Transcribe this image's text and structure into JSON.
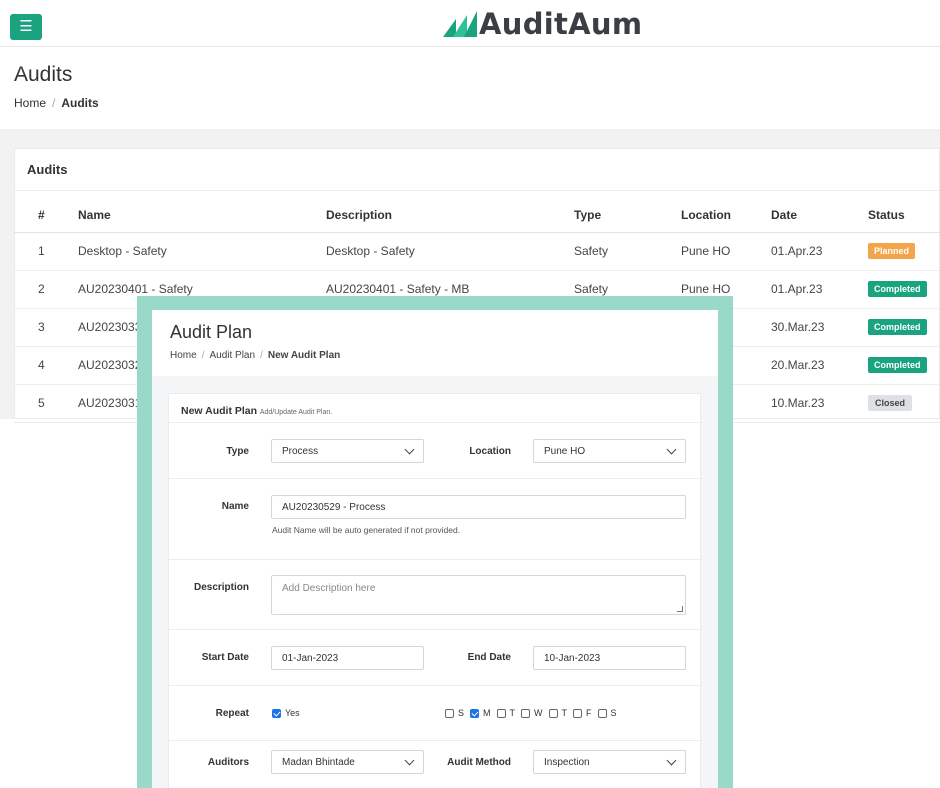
{
  "brand": {
    "name": "AuditAum",
    "accent": "#1aa37f"
  },
  "icons": {
    "menu": "hamburger-icon",
    "logo": "auditaum-logo-mark",
    "chevron": "chevron-down-icon",
    "check": "checkbox-icon"
  },
  "page": {
    "title": "Audits",
    "breadcrumb": {
      "home": "Home",
      "current": "Audits"
    }
  },
  "audits_card": {
    "title": "Audits",
    "columns": [
      "#",
      "Name",
      "Description",
      "Type",
      "Location",
      "Date",
      "Status"
    ],
    "rows": [
      {
        "num": "1",
        "name": "Desktop - Safety",
        "description": "Desktop - Safety",
        "type": "Safety",
        "location": "Pune HO",
        "date": "01.Apr.23",
        "status": "Planned"
      },
      {
        "num": "2",
        "name": "AU20230401 - Safety",
        "description": "AU20230401 - Safety - MB",
        "type": "Safety",
        "location": "Pune HO",
        "date": "01.Apr.23",
        "status": "Completed"
      },
      {
        "num": "3",
        "name": "AU2023033",
        "description": "",
        "type": "",
        "location": "",
        "date": "30.Mar.23",
        "status": "Completed"
      },
      {
        "num": "4",
        "name": "AU2023032",
        "description": "",
        "type": "",
        "location": "",
        "date": "20.Mar.23",
        "status": "Completed"
      },
      {
        "num": "5",
        "name": "AU2023031",
        "description": "",
        "type": "",
        "location": "",
        "date": "10.Mar.23",
        "status": "Closed"
      }
    ]
  },
  "modal": {
    "title": "Audit Plan",
    "breadcrumb": {
      "home": "Home",
      "parent": "Audit Plan",
      "current": "New Audit Plan"
    },
    "form": {
      "heading": "New Audit Plan",
      "subheading": "Add/Update Audit Plan.",
      "type": {
        "label": "Type",
        "value": "Process"
      },
      "location": {
        "label": "Location",
        "value": "Pune HO"
      },
      "name": {
        "label": "Name",
        "value": "AU20230529 - Process",
        "hint": "Audit Name will be auto generated if not provided."
      },
      "description": {
        "label": "Description",
        "placeholder": "Add Description here"
      },
      "start_date": {
        "label": "Start Date",
        "value": "01-Jan-2023"
      },
      "end_date": {
        "label": "End Date",
        "value": "10-Jan-2023"
      },
      "repeat": {
        "label": "Repeat",
        "option": "Yes",
        "checked": true
      },
      "days": [
        {
          "label": "S",
          "checked": false
        },
        {
          "label": "M",
          "checked": true
        },
        {
          "label": "T",
          "checked": false
        },
        {
          "label": "W",
          "checked": false
        },
        {
          "label": "T",
          "checked": false
        },
        {
          "label": "F",
          "checked": false
        },
        {
          "label": "S",
          "checked": false
        }
      ],
      "auditors": {
        "label": "Auditors",
        "value": "Madan Bhintade"
      },
      "audit_method": {
        "label": "Audit Method",
        "value": "Inspection"
      }
    }
  }
}
